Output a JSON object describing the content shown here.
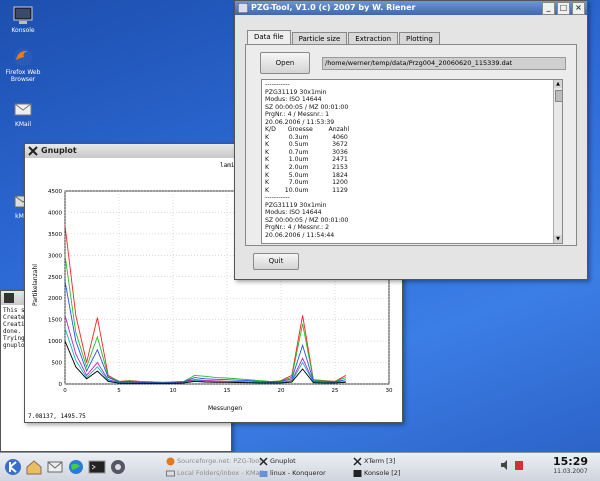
{
  "desktop": {
    "icons": [
      {
        "label": "Konsole"
      },
      {
        "label": "Firefox Web Browser"
      },
      {
        "label": "KMail"
      },
      {
        "label": "kMail"
      }
    ]
  },
  "terminal": {
    "lines": [
      "This sc",
      "Create_",
      "Creatin",
      "done.",
      "Trying",
      "gnuplot"
    ]
  },
  "gnuplot_window": {
    "title": "Gnuplot",
    "coords": "7.08137,  1495.75"
  },
  "chart_data": {
    "type": "line",
    "title": "laminarflow_part",
    "xlabel": "Messungen",
    "ylabel": "Partikelanzahl",
    "xlim": [
      0,
      30
    ],
    "ylim": [
      0,
      4500
    ],
    "xticks": [
      "0",
      "5",
      "10",
      "15",
      "20",
      "25",
      "30"
    ],
    "yticks": [
      "0",
      "500",
      "1000",
      "1500",
      "2000",
      "2500",
      "3000",
      "3500",
      "4000",
      "4500"
    ],
    "grid": true,
    "series": [
      {
        "color": "#ff2020",
        "x": [
          0,
          1,
          2,
          3,
          4,
          5,
          6,
          7,
          8,
          9,
          10,
          11,
          12,
          13,
          14,
          15,
          16,
          17,
          18,
          19,
          20,
          21,
          22,
          23,
          24,
          25,
          26
        ],
        "values": [
          3700,
          1600,
          500,
          1550,
          200,
          60,
          80,
          60,
          50,
          40,
          40,
          60,
          100,
          80,
          70,
          60,
          50,
          40,
          40,
          30,
          80,
          200,
          1600,
          100,
          80,
          60,
          200
        ]
      },
      {
        "color": "#20c020",
        "x": [
          0,
          1,
          2,
          3,
          4,
          5,
          6,
          7,
          8,
          9,
          10,
          11,
          12,
          13,
          14,
          15,
          16,
          17,
          18,
          19,
          20,
          21,
          22,
          23,
          24,
          25,
          26
        ],
        "values": [
          3000,
          1200,
          400,
          1100,
          180,
          60,
          70,
          50,
          50,
          40,
          50,
          60,
          200,
          180,
          150,
          140,
          120,
          100,
          80,
          60,
          70,
          160,
          1400,
          90,
          70,
          60,
          150
        ]
      },
      {
        "color": "#2050ff",
        "x": [
          0,
          1,
          2,
          3,
          4,
          5,
          6,
          7,
          8,
          9,
          10,
          11,
          12,
          13,
          14,
          15,
          16,
          17,
          18,
          19,
          20,
          21,
          22,
          23,
          24,
          25,
          26
        ],
        "values": [
          2400,
          1000,
          300,
          800,
          150,
          50,
          60,
          40,
          40,
          30,
          40,
          50,
          150,
          120,
          110,
          100,
          90,
          80,
          60,
          50,
          60,
          120,
          900,
          70,
          60,
          50,
          100
        ]
      },
      {
        "color": "#c020c0",
        "x": [
          0,
          1,
          2,
          3,
          4,
          5,
          6,
          7,
          8,
          9,
          10,
          11,
          12,
          13,
          14,
          15,
          16,
          17,
          18,
          19,
          20,
          21,
          22,
          23,
          24,
          25,
          26
        ],
        "values": [
          1600,
          700,
          200,
          500,
          100,
          40,
          40,
          30,
          30,
          20,
          30,
          40,
          100,
          80,
          70,
          60,
          60,
          50,
          40,
          40,
          40,
          80,
          600,
          50,
          40,
          40,
          60
        ]
      },
      {
        "color": "#00c0c0",
        "x": [
          0,
          1,
          2,
          3,
          4,
          5,
          6,
          7,
          8,
          9,
          10,
          11,
          12,
          13,
          14,
          15,
          16,
          17,
          18,
          19,
          20,
          21,
          22,
          23,
          24,
          25,
          26
        ],
        "values": [
          1300,
          550,
          150,
          400,
          80,
          30,
          30,
          25,
          25,
          20,
          25,
          30,
          80,
          60,
          55,
          50,
          45,
          40,
          35,
          30,
          35,
          60,
          500,
          40,
          35,
          30,
          50
        ]
      },
      {
        "color": "#000000",
        "x": [
          0,
          1,
          2,
          3,
          4,
          5,
          6,
          7,
          8,
          9,
          10,
          11,
          12,
          13,
          14,
          15,
          16,
          17,
          18,
          19,
          20,
          21,
          22,
          23,
          24,
          25,
          26
        ],
        "values": [
          1000,
          400,
          120,
          300,
          60,
          20,
          20,
          20,
          20,
          15,
          20,
          25,
          60,
          45,
          40,
          40,
          35,
          30,
          25,
          25,
          25,
          45,
          350,
          30,
          25,
          25,
          40
        ]
      }
    ]
  },
  "pzg": {
    "title": "PZG-Tool, V1.0 (c) 2007 by W. Riener",
    "tabs": [
      "Data file",
      "Particle size",
      "Extraction",
      "Plotting"
    ],
    "open_label": "Open",
    "path": "/home/werner/temp/data/Przg004_20060620_115339.dat",
    "quit_label": "Quit",
    "lines": [
      "-----------",
      "PZG31119 30x1min",
      "Modus: ISO 14644",
      "SZ 00:00:05 / MZ 00:01:00",
      "PrgNr.: 4 / Messnr.: 1",
      "20.06.2006 / 11:53:39",
      "K/D      Groesse        Anzahl",
      "K          0.3um            4060",
      "K          0.5um            3672",
      "K          0.7um            3036",
      "K          1.0um            2471",
      "K          2.0um            2153",
      "K          5.0um            1824",
      "K          7.0um            1200",
      "K        10.0um            1129",
      "-----------",
      "PZG31119 30x1min",
      "Modus: ISO 14644",
      "SZ 00:00:05 / MZ 00:01:00",
      "PrgNr.: 4 / Messnr.: 2",
      "20.06.2006 / 11:54:44"
    ]
  },
  "taskbar": {
    "tasks": [
      {
        "label": "Sourceforge.net: PZG-Tool",
        "dim": true
      },
      {
        "label": "Gnuplot",
        "dim": false
      },
      {
        "label": "XTerm [3]",
        "dim": false
      },
      {
        "label": "Local Folders/inbox - KMail",
        "dim": true
      },
      {
        "label": "linux - Konqueror",
        "dim": false
      },
      {
        "label": "Konsole [2]",
        "dim": false
      }
    ],
    "time": "15:29",
    "date": "11.03.2007"
  }
}
